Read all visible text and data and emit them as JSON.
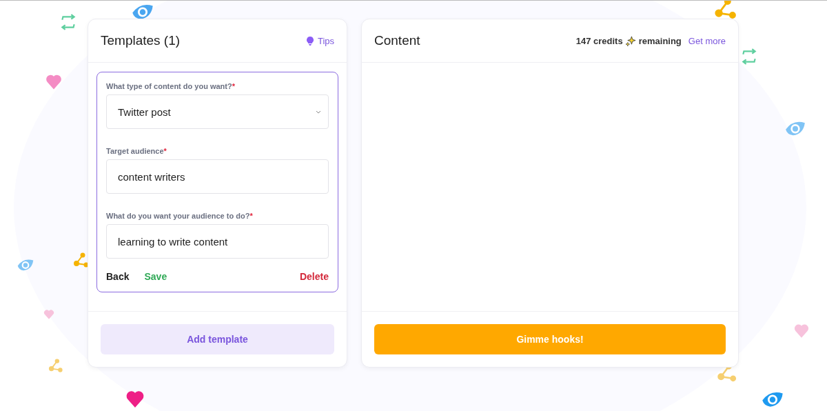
{
  "templates_panel": {
    "title": "Templates (1)",
    "tips_link": "Tips",
    "form": {
      "fields": [
        {
          "kind": "select",
          "label": "What type of content do you want?",
          "required_mark": "*",
          "value": "Twitter post"
        },
        {
          "kind": "text",
          "label": "Target audience",
          "required_mark": "*",
          "value": "content writers"
        },
        {
          "kind": "text",
          "label": "What do you want your audience to do?",
          "required_mark": "*",
          "value": "learning to write content"
        }
      ],
      "actions": {
        "back": "Back",
        "save": "Save",
        "delete": "Delete"
      }
    },
    "add_button": "Add template"
  },
  "content_panel": {
    "title": "Content",
    "credits_count": "147 credits",
    "credits_suffix": "remaining",
    "get_more_link": "Get more",
    "generate_button": "Gimme hooks!"
  }
}
